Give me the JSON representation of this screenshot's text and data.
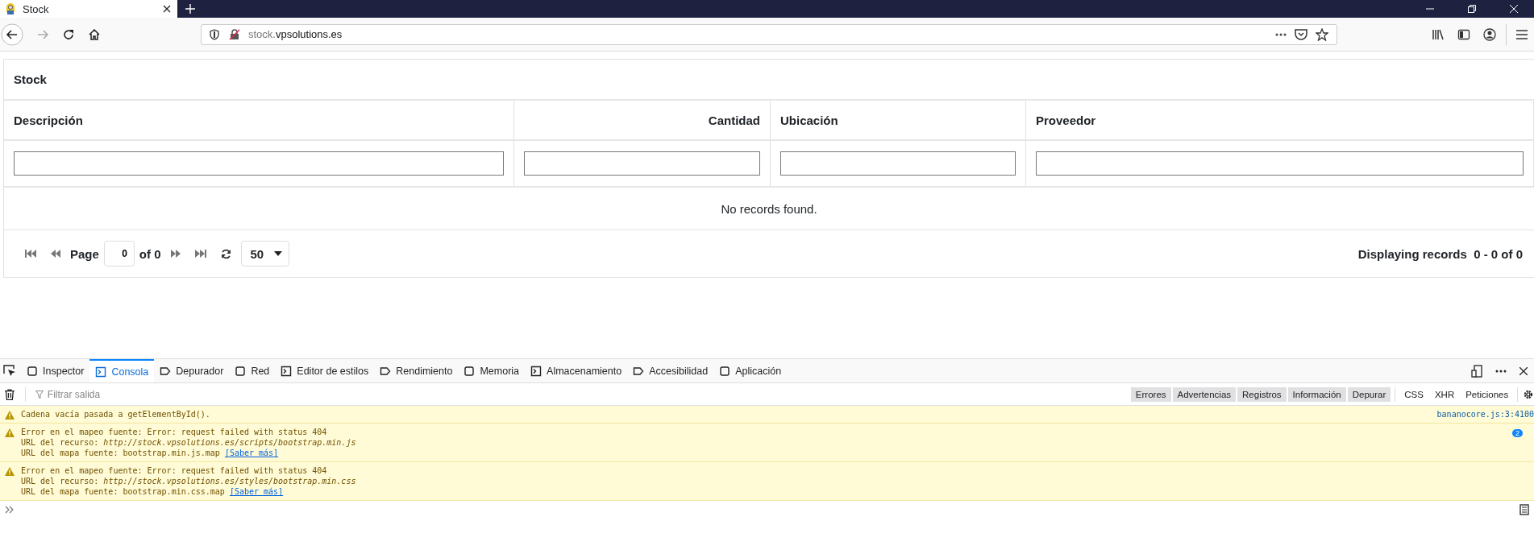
{
  "browser": {
    "tab": {
      "title": "Stock"
    },
    "navigation": {
      "back_disabled": false,
      "forward_disabled": true
    },
    "url": {
      "subdomain": "stock.",
      "domain": "vpsolutions.es"
    }
  },
  "panel": {
    "title": "Stock",
    "columns": [
      {
        "label": "Descripción",
        "right_aligned": false
      },
      {
        "label": "Cantidad",
        "right_aligned": true
      },
      {
        "label": "Ubicación",
        "right_aligned": false
      },
      {
        "label": "Proveedor",
        "right_aligned": false
      }
    ],
    "empty_message": "No records found.",
    "pagination": {
      "page_label": "Page",
      "page_value": "0",
      "of_label": "of 0",
      "rows_per_page": "50",
      "summary": "Displaying records  0 - 0 of 0"
    }
  },
  "devtools": {
    "tabs": [
      {
        "label": "Inspector",
        "selected": false
      },
      {
        "label": "Consola",
        "selected": true
      },
      {
        "label": "Depurador",
        "selected": false
      },
      {
        "label": "Red",
        "selected": false
      },
      {
        "label": "Editor de estilos",
        "selected": false
      },
      {
        "label": "Rendimiento",
        "selected": false
      },
      {
        "label": "Memoria",
        "selected": false
      },
      {
        "label": "Almacenamiento",
        "selected": false
      },
      {
        "label": "Accesibilidad",
        "selected": false
      },
      {
        "label": "Aplicación",
        "selected": false
      }
    ],
    "filter": {
      "placeholder": "Filtrar salida"
    },
    "level_filters": [
      {
        "label": "Errores",
        "on": true
      },
      {
        "label": "Advertencias",
        "on": true
      },
      {
        "label": "Registros",
        "on": true
      },
      {
        "label": "Información",
        "on": true
      },
      {
        "label": "Depurar",
        "on": true
      },
      {
        "label": "CSS",
        "on": false
      },
      {
        "label": "XHR",
        "on": false
      },
      {
        "label": "Peticiones",
        "on": false
      }
    ],
    "messages": [
      {
        "lines": [
          {
            "kind": "plain",
            "text": "Cadena vacía pasada a getElementById()."
          }
        ],
        "source": "bananocore.js:3:4100"
      },
      {
        "lines": [
          {
            "kind": "plain",
            "text": "Error en el mapeo fuente: Error: request failed with status 404"
          },
          {
            "kind": "url",
            "label": "URL del recurso:",
            "url": "http://stock.vpsolutions.es/scripts/bootstrap.min.js"
          },
          {
            "kind": "map",
            "label": "URL del mapa fuente: bootstrap.min.js.map",
            "link": "[Saber más]"
          }
        ],
        "count": "2"
      },
      {
        "lines": [
          {
            "kind": "plain",
            "text": "Error en el mapeo fuente: Error: request failed with status 404"
          },
          {
            "kind": "url",
            "label": "URL del recurso:",
            "url": "http://stock.vpsolutions.es/styles/bootstrap.min.css"
          },
          {
            "kind": "map",
            "label": "URL del mapa fuente: bootstrap.min.css.map",
            "link": "[Saber más]"
          }
        ]
      }
    ]
  }
}
